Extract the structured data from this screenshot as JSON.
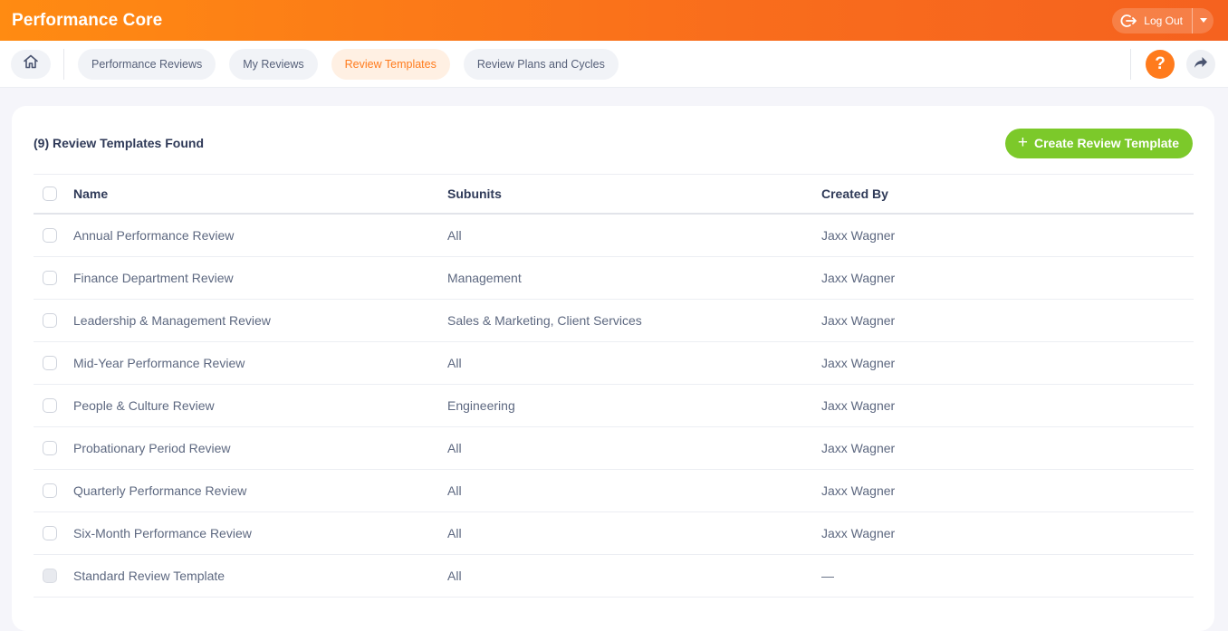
{
  "app": {
    "title": "Performance Core",
    "logout_label": "Log Out"
  },
  "nav": {
    "tabs": [
      {
        "label": "Performance Reviews",
        "active": false
      },
      {
        "label": "My Reviews",
        "active": false
      },
      {
        "label": "Review Templates",
        "active": true
      },
      {
        "label": "Review Plans and Cycles",
        "active": false
      }
    ],
    "help_label": "?"
  },
  "main": {
    "count_title": "(9) Review Templates Found",
    "create_button_label": "Create Review Template",
    "columns": [
      "Name",
      "Subunits",
      "Created By"
    ],
    "rows": [
      {
        "name": "Annual Performance Review",
        "subunits": "All",
        "created_by": "Jaxx Wagner",
        "selectable": true
      },
      {
        "name": "Finance Department Review",
        "subunits": "Management",
        "created_by": "Jaxx Wagner",
        "selectable": true
      },
      {
        "name": "Leadership & Management Review",
        "subunits": "Sales & Marketing, Client Services",
        "created_by": "Jaxx Wagner",
        "selectable": true
      },
      {
        "name": "Mid-Year Performance Review",
        "subunits": "All",
        "created_by": "Jaxx Wagner",
        "selectable": true
      },
      {
        "name": "People & Culture Review",
        "subunits": "Engineering",
        "created_by": "Jaxx Wagner",
        "selectable": true
      },
      {
        "name": "Probationary Period Review",
        "subunits": "All",
        "created_by": "Jaxx Wagner",
        "selectable": true
      },
      {
        "name": "Quarterly Performance Review",
        "subunits": "All",
        "created_by": "Jaxx Wagner",
        "selectable": true
      },
      {
        "name": "Six-Month Performance Review",
        "subunits": "All",
        "created_by": "Jaxx Wagner",
        "selectable": true
      },
      {
        "name": "Standard Review Template",
        "subunits": "All",
        "created_by": "—",
        "selectable": false
      }
    ]
  },
  "colors": {
    "brand_orange": "#ff7b1d",
    "create_green": "#7cc92a",
    "active_tab_bg": "#fff0e3"
  },
  "icons": [
    "home-icon",
    "logout-icon",
    "chevron-down-icon",
    "help-icon",
    "share-icon",
    "plus-icon"
  ]
}
